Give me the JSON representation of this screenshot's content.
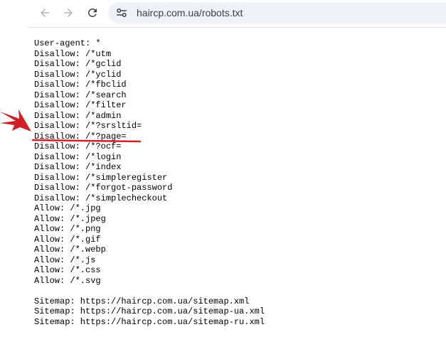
{
  "browser": {
    "url": "haircp.com.ua/robots.txt",
    "icons": {
      "back": "arrow-left-icon",
      "forward": "arrow-right-icon",
      "reload": "reload-icon",
      "site_info": "tune-icon"
    }
  },
  "robots": {
    "lines": [
      "User-agent: *",
      "Disallow: /*utm",
      "Disallow: /*gclid",
      "Disallow: /*yclid",
      "Disallow: /*fbclid",
      "Disallow: /*search",
      "Disallow: /*filter",
      "Disallow: /*admin",
      "Disallow: /*?srsltid=",
      "Disallow: /*?page=",
      "Disallow: /*?ocf=",
      "Disallow: /*login",
      "Disallow: /*index",
      "Disallow: /*simpleregister",
      "Disallow: /*forgot-password",
      "Disallow: /*simplecheckout",
      "Allow: /*.jpg",
      "Allow: /*.jpeg",
      "Allow: /*.png",
      "Allow: /*.gif",
      "Allow: /*.webp",
      "Allow: /*.js",
      "Allow: /*.css",
      "Allow: /*.svg",
      "",
      "Sitemap: https://haircp.com.ua/sitemap.xml",
      "Sitemap: https://haircp.com.ua/sitemap-ua.xml",
      "Sitemap: https://haircp.com.ua/sitemap-ru.xml"
    ]
  },
  "annotation": {
    "color": "#d01f26",
    "highlighted_line": "Disallow: /*?page="
  }
}
